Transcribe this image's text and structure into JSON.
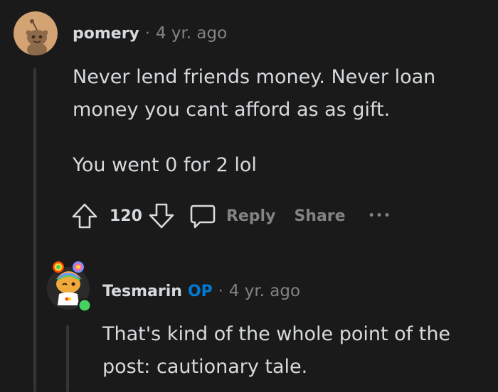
{
  "comment": {
    "username": "pomery",
    "separator": "·",
    "time": "4 yr. ago",
    "paragraph1_line1": "Never lend friends money. Never loan",
    "paragraph1_line2": "money you cant afford as as gift.",
    "paragraph2": "You went 0 for 2 lol",
    "vote_count": "120",
    "reply_label": "Reply",
    "share_label": "Share",
    "more_label": "•••"
  },
  "reply": {
    "username": "Tesmarin",
    "op_badge": "OP",
    "separator": "·",
    "time": "4 yr. ago",
    "line1": "That's kind of the whole point of the",
    "line2": "post: cautionary tale."
  },
  "colors": {
    "background": "#1a1a1b",
    "text": "#d7dadc",
    "muted": "#818384",
    "op_blue": "#0079d3",
    "online_green": "#46d160",
    "avatar_tan": "#d4a373"
  }
}
